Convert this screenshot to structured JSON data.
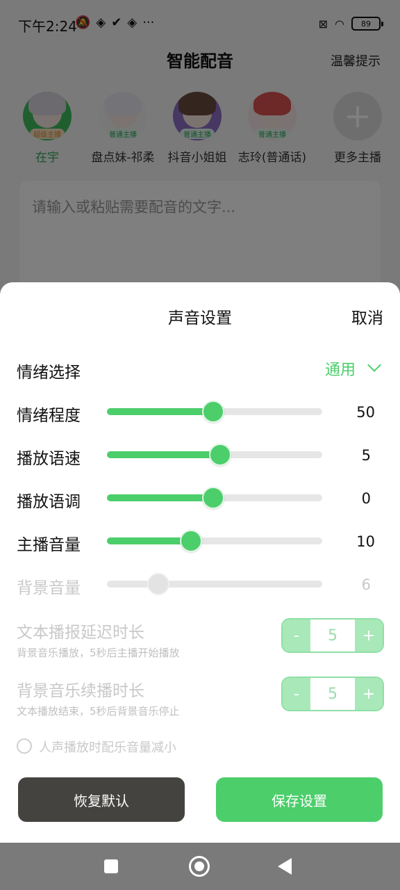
{
  "status_bar": {
    "time": "下午2:24",
    "left_icons": [
      "mute-icon",
      "app-icon",
      "check-icon",
      "app-icon",
      "more-icon"
    ],
    "battery": "89"
  },
  "header": {
    "title": "智能配音",
    "tips": "温馨提示"
  },
  "anchors": [
    {
      "name": "在宇",
      "tag": "超级主播",
      "active": true,
      "hair": "#d9d5dc",
      "ring": "#3fbf5f"
    },
    {
      "name": "盘点妹-祁柔",
      "tag": "普通主播",
      "active": false,
      "hair": "#e9e6ee",
      "ring": "#f1f1f1"
    },
    {
      "name": "抖音小姐姐",
      "tag": "普通主播",
      "active": false,
      "hair": "#6b4a3f",
      "ring": "#8c6fc7"
    },
    {
      "name": "志玲(普通话)",
      "tag": "普通主播",
      "active": false,
      "hair": "#d9534f",
      "ring": "#f6e6e6"
    }
  ],
  "add_anchor_label": "更多主播",
  "text_input_placeholder": "请输入或粘贴需要配音的文字...",
  "sheet": {
    "title": "声音设置",
    "cancel": "取消",
    "emotion": {
      "label": "情绪选择",
      "value": "通用"
    },
    "sliders": [
      {
        "label": "情绪程度",
        "value": "50",
        "fraction": 0.495,
        "enabled": true
      },
      {
        "label": "播放语速",
        "value": "5",
        "fraction": 0.525,
        "enabled": true
      },
      {
        "label": "播放语调",
        "value": "0",
        "fraction": 0.495,
        "enabled": true
      },
      {
        "label": "主播音量",
        "value": "10",
        "fraction": 0.39,
        "enabled": true
      },
      {
        "label": "背景音量",
        "value": "6",
        "fraction": 0.24,
        "enabled": false
      }
    ],
    "steppers": [
      {
        "label": "文本播报延迟时长",
        "sub": "背景音乐播放，5秒后主播开始播放",
        "value": "5",
        "minus": "-",
        "plus": "+"
      },
      {
        "label": "背景音乐续播时长",
        "sub": "文本播放结束，5秒后背景音乐停止",
        "value": "5",
        "minus": "-",
        "plus": "+"
      }
    ],
    "checkbox_label": "人声播放时配乐音量减小",
    "reset_button": "恢复默认",
    "save_button": "保存设置"
  },
  "colors": {
    "accent": "#4cce6b",
    "dark_button": "#454340"
  }
}
